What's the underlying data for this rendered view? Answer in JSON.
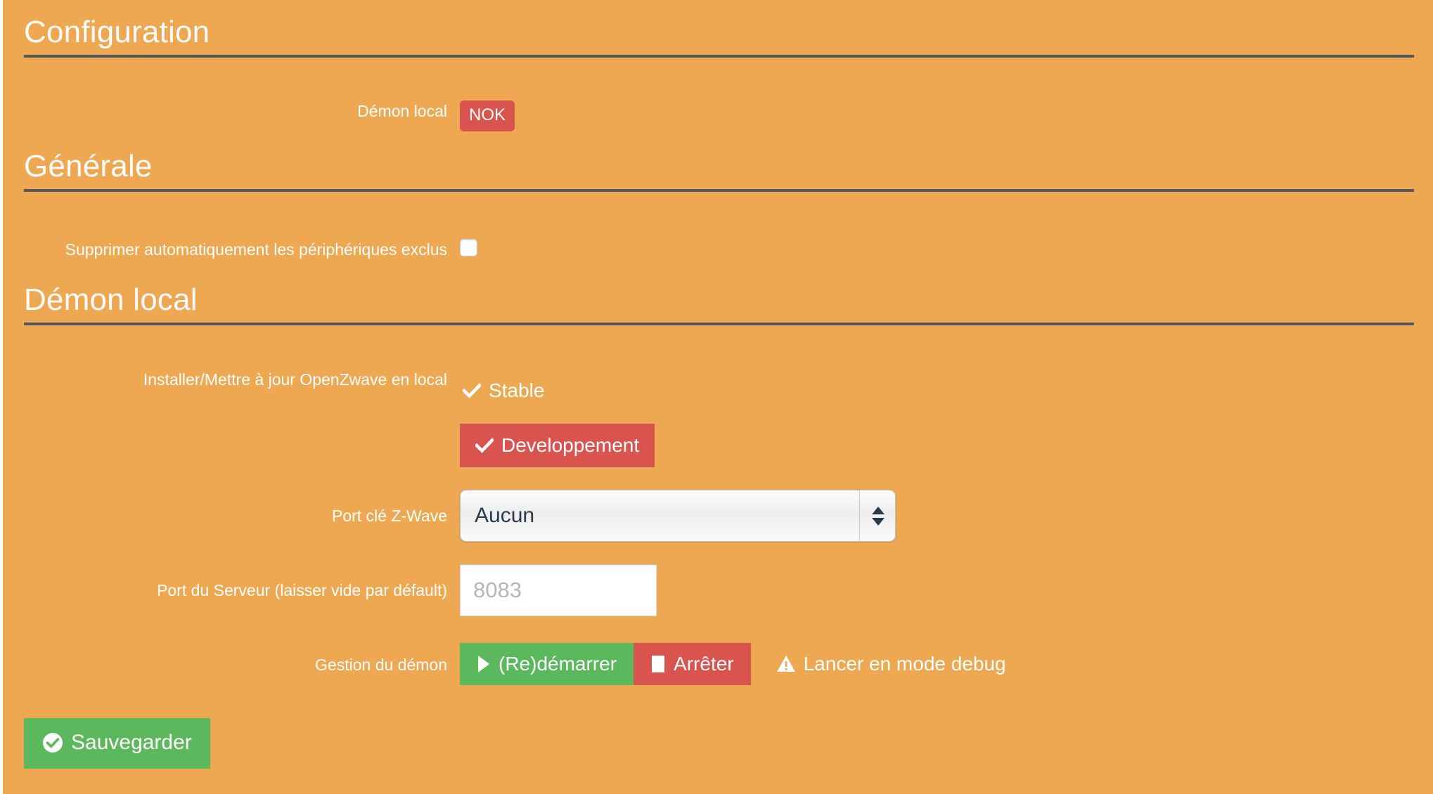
{
  "theme": {
    "background": "#eda851",
    "rule": "#54585e",
    "danger": "#d9534f",
    "success": "#5cb85c",
    "heading_text": "#fbfbfb",
    "label_text": "#ffffff"
  },
  "sections": [
    {
      "title": "Configuration"
    },
    {
      "title": "Générale"
    },
    {
      "title": "Démon local"
    }
  ],
  "daemon_status": {
    "label": "Démon local",
    "badge": "NOK",
    "badge_color": "#d9534f"
  },
  "general": {
    "auto_delete_label": "Supprimer automatiquement les périphériques exclus",
    "auto_delete_checked": false
  },
  "local_daemon": {
    "install_label": "Installer/Mettre à jour OpenZwave en local",
    "stable_button": "Stable",
    "stable_icon": "check-icon",
    "dev_button": "Developpement",
    "dev_icon": "check-icon",
    "port_key_label": "Port clé Z-Wave",
    "port_key_value": "Aucun",
    "port_key_options": [
      "Aucun"
    ],
    "server_port_label": "Port du Serveur (laisser vide par défault)",
    "server_port_value": "",
    "server_port_placeholder": "8083",
    "daemon_mgmt_label": "Gestion du démon",
    "restart_button": "(Re)démarrer",
    "restart_icon": "play-icon",
    "stop_button": "Arrêter",
    "stop_icon": "stop-icon",
    "debug_button": "Lancer en mode debug",
    "debug_icon": "warning-icon"
  },
  "footer": {
    "save_button": "Sauvegarder",
    "save_icon": "check-circle-icon"
  }
}
